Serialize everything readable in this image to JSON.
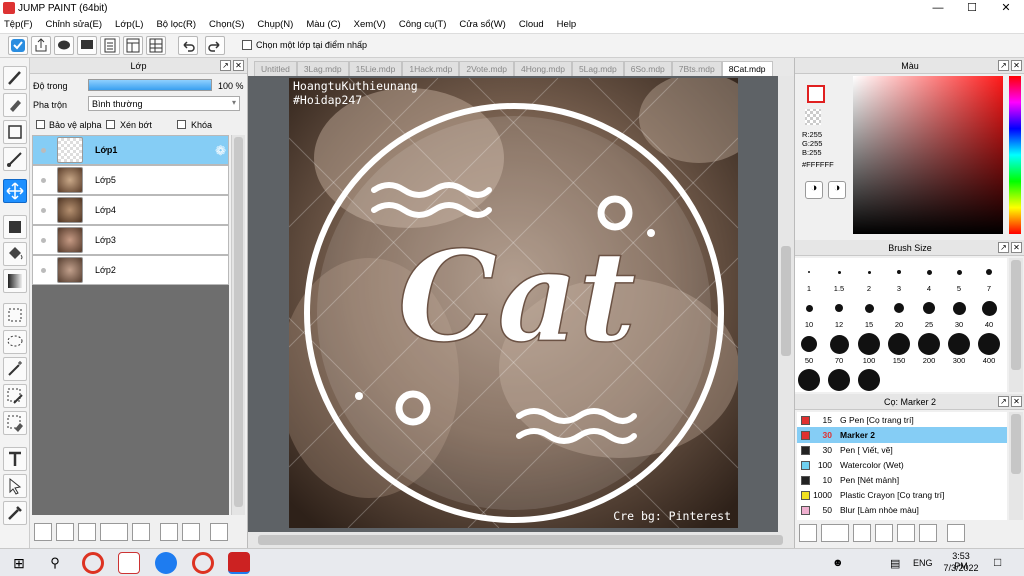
{
  "window": {
    "title": "JUMP PAINT (64bit)"
  },
  "menu": [
    "Tệp(F)",
    "Chỉnh sửa(E)",
    "Lớp(L)",
    "Bộ lọc(R)",
    "Chọn(S)",
    "Chụp(N)",
    "Màu (C)",
    "Xem(V)",
    "Công cụ(T)",
    "Cửa sổ(W)",
    "Cloud",
    "Help"
  ],
  "toolbar": {
    "checkbox_label": "Chọn một lớp tại điểm nhấp"
  },
  "layer_panel": {
    "title": "Lớp",
    "opacity_label": "Độ trong",
    "opacity_value": "100 %",
    "opacity_fraction": 1.0,
    "blend_label": "Pha trộn",
    "blend_value": "Bình thường",
    "protect_alpha": "Bảo vệ alpha",
    "clipping": "Xén bớt",
    "lock": "Khóa",
    "layers": [
      {
        "name": "Lớp1",
        "selected": true
      },
      {
        "name": "Lớp5",
        "selected": false
      },
      {
        "name": "Lớp4",
        "selected": false
      },
      {
        "name": "Lớp3",
        "selected": false
      },
      {
        "name": "Lớp2",
        "selected": false
      }
    ]
  },
  "tabs": [
    "Untitled",
    "3Lag.mdp",
    "15Lie.mdp",
    "1Hack.mdp",
    "2Vote.mdp",
    "4Hong.mdp",
    "5Lag.mdp",
    "6So.mdp",
    "7Bts.mdp",
    "8Cat.mdp"
  ],
  "active_tab": "8Cat.mdp",
  "artwork": {
    "top_text_line1": "HoangtuKuthieunang",
    "top_text_line2": "#Hoidap247",
    "main_text": "Cat",
    "credit": "Cre bg: Pinterest"
  },
  "color_panel": {
    "title": "Màu",
    "r": "R:255",
    "g": "G:255",
    "b": "B:255",
    "hex": "#FFFFFF"
  },
  "brush_size_panel": {
    "title": "Brush Size",
    "sizes": [
      "1",
      "1.5",
      "2",
      "3",
      "4",
      "5",
      "7",
      "10",
      "12",
      "15",
      "20",
      "25",
      "30",
      "40",
      "50",
      "70",
      "100",
      "150",
      "200",
      "300",
      "400"
    ]
  },
  "brush_panel": {
    "title": "Cọ: Marker 2",
    "brushes": [
      {
        "size": "15",
        "name": "G Pen [Cọ trang trí]",
        "color": "#e03030",
        "selected": false
      },
      {
        "size": "30",
        "name": "Marker 2",
        "color": "#e03030",
        "selected": true
      },
      {
        "size": "30",
        "name": "Pen [ Viết, vẽ]",
        "color": "#222222",
        "selected": false
      },
      {
        "size": "100",
        "name": "Watercolor (Wet)",
        "color": "#6fd0f0",
        "selected": false
      },
      {
        "size": "10",
        "name": "Pen [Nét mảnh]",
        "color": "#222222",
        "selected": false
      },
      {
        "size": "1000",
        "name": "Plastic Crayon [Cọ trang trí]",
        "color": "#f0e020",
        "selected": false
      },
      {
        "size": "50",
        "name": "Blur [Làm nhòe màu]",
        "color": "#f0b0d0",
        "selected": false
      }
    ]
  },
  "taskbar": {
    "time": "3:53 PM",
    "date": "7/3/2022",
    "lang": "ENG"
  },
  "colors": {
    "accent": "#1e90ff",
    "selected_layer": "#85cdf5",
    "canvas_bg": "#5e6266"
  }
}
